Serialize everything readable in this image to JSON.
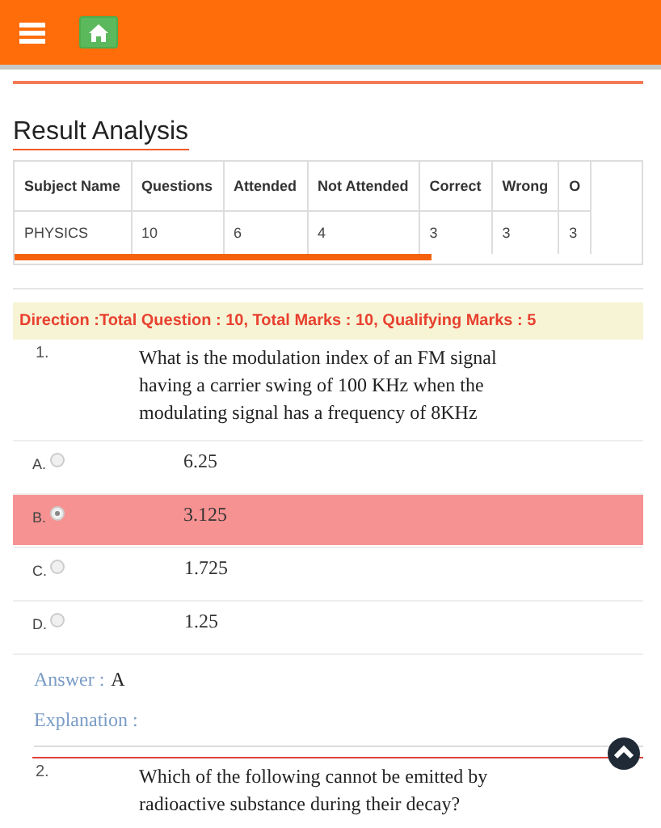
{
  "title": "Result Analysis",
  "table": {
    "columns": [
      "Subject Name",
      "Questions",
      "Attended",
      "Not Attended",
      "Correct",
      "Wrong",
      "O"
    ],
    "rows": [
      [
        "PHYSICS",
        "10",
        "6",
        "4",
        "3",
        "3",
        "3"
      ]
    ]
  },
  "direction": "Direction :Total Question : 10, Total Marks : 10, Qualifying Marks : 5",
  "questions": [
    {
      "number": "1.",
      "text": "What is the modulation index of an FM signal having a carrier swing of 100 KHz when the modulating signal has a frequency of  8KHz",
      "options": [
        {
          "letter": "A.",
          "text": "6.25",
          "selected": false
        },
        {
          "letter": "B.",
          "text": "3.125",
          "selected": true
        },
        {
          "letter": "C.",
          "text": "1.725",
          "selected": false
        },
        {
          "letter": "D.",
          "text": "1.25",
          "selected": false
        }
      ],
      "answer_label": "Answer :",
      "answer": "A",
      "explanation_label": "Explanation :"
    },
    {
      "number": "2.",
      "text": "Which of the following cannot be emitted by radioactive substance during their decay?"
    }
  ]
}
